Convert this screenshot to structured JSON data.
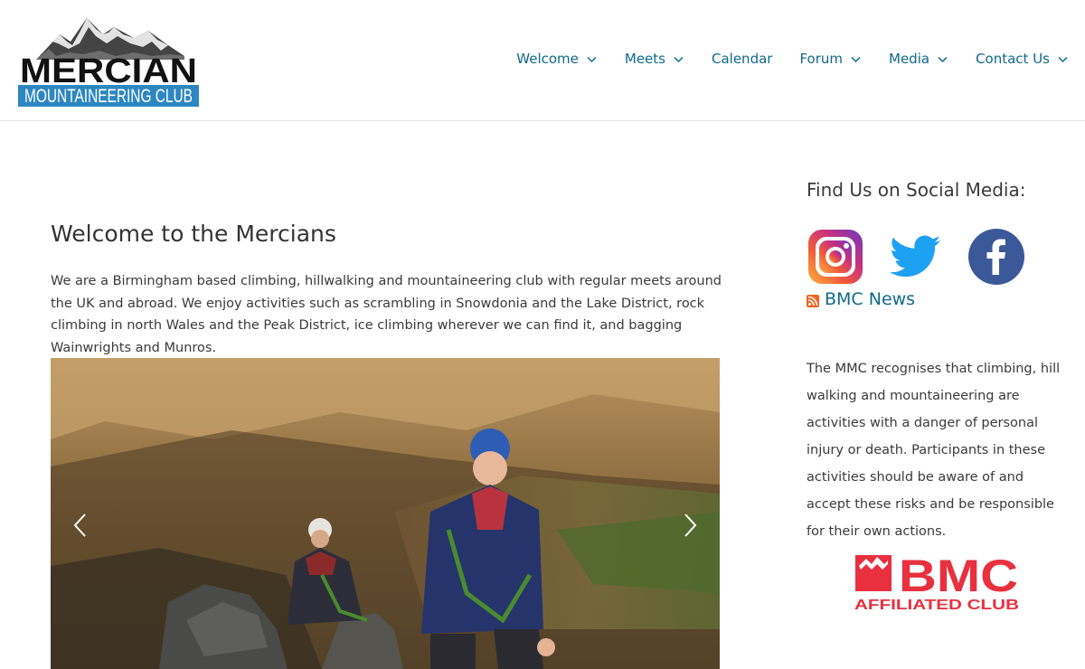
{
  "header": {
    "logo": {
      "line1": "MERCIAN",
      "line2": "MOUNTAINEERING CLUB"
    },
    "nav": [
      {
        "label": "Welcome",
        "has_dropdown": true
      },
      {
        "label": "Meets",
        "has_dropdown": true
      },
      {
        "label": "Calendar",
        "has_dropdown": false
      },
      {
        "label": "Forum",
        "has_dropdown": true
      },
      {
        "label": "Media",
        "has_dropdown": true
      },
      {
        "label": "Contact Us",
        "has_dropdown": true
      }
    ]
  },
  "main": {
    "title": "Welcome to the Mercians",
    "intro": "We are a Birmingham based climbing, hillwalking and mountaineering club with regular meets around the UK and abroad. We enjoy activities such as scrambling in Snowdonia and the Lake District, rock climbing in north Wales and the Peak District, ice climbing wherever we can find it, and bagging Wainwrights and Munros."
  },
  "sidebar": {
    "social_title": "Find Us on Social Media:",
    "social_icons": [
      "instagram-icon",
      "twitter-icon",
      "facebook-icon"
    ],
    "rss_label": "BMC News",
    "disclaimer": "The MMC recognises that climbing, hill walking and mountaineering are activities with a danger of personal injury or death. Participants in these activities should be aware of and accept these risks and be responsible for their own actions.",
    "bmc_logo": {
      "line1": "BMC",
      "line2": "AFFILIATED CLUB"
    }
  },
  "colors": {
    "link": "#0f6a8b",
    "logo_blue": "#2d86c1",
    "bmc_red": "#e8303f",
    "facebook_blue": "#3b5998",
    "twitter_blue": "#1da1f2",
    "rss_orange": "#f26522"
  }
}
